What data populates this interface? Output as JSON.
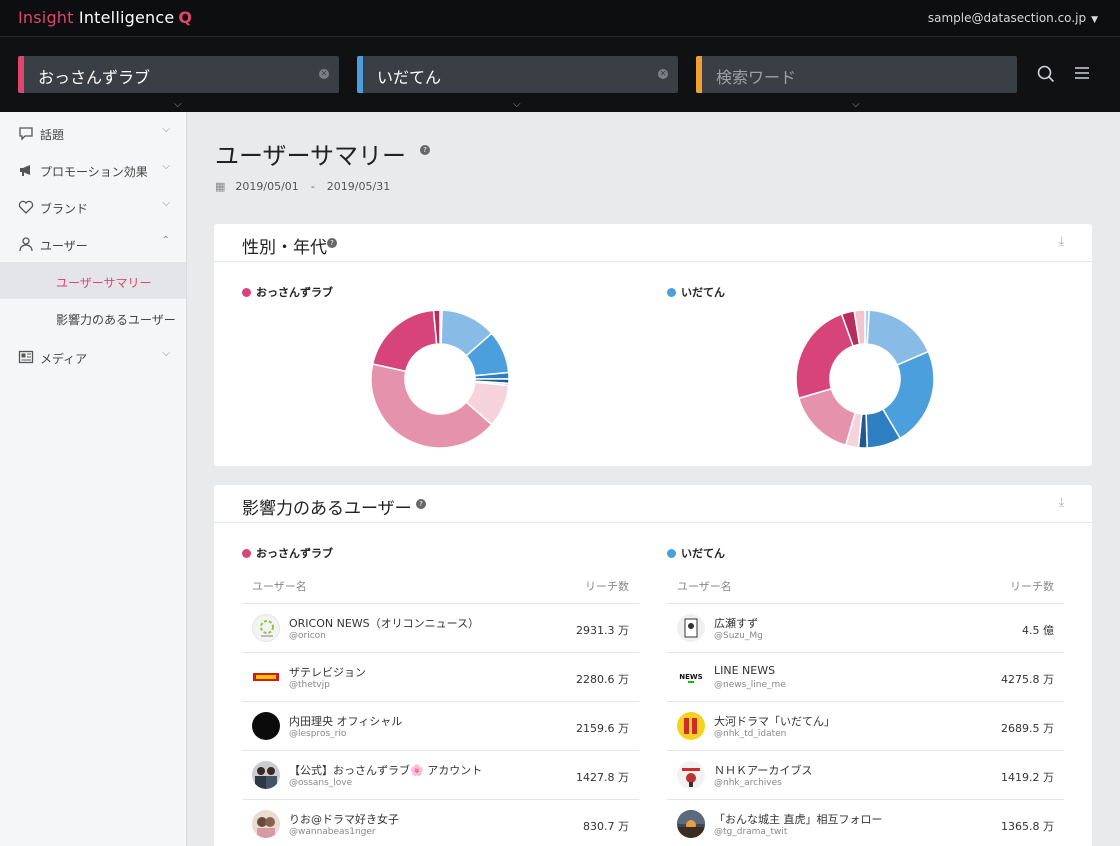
{
  "app": {
    "logo_part1": "Insight",
    "logo_part2": " Intelligence",
    "logo_mark": "Q",
    "user_email": "sample@datasection.co.jp",
    "accent": "#e0456f"
  },
  "search": {
    "fields": [
      {
        "value": "おっさんずラブ",
        "bar_color": "#e0456f"
      },
      {
        "value": "いだてん",
        "bar_color": "#4a9fdc"
      },
      {
        "value": "",
        "placeholder": "検索ワード",
        "bar_color": "#f0a030"
      }
    ]
  },
  "sidebar": {
    "items": [
      {
        "label": "話題",
        "icon": "speech-bubble-icon"
      },
      {
        "label": "プロモーション効果",
        "icon": "megaphone-icon"
      },
      {
        "label": "ブランド",
        "icon": "heart-icon"
      },
      {
        "label": "ユーザー",
        "icon": "user-icon"
      },
      {
        "label": "メディア",
        "icon": "newspaper-icon"
      }
    ],
    "subitems": [
      {
        "label": "ユーザーサマリー",
        "active": true
      },
      {
        "label": "影響力のあるユーザー",
        "active": false
      }
    ]
  },
  "page": {
    "title": "ユーザーサマリー",
    "date_from": "2019/05/01",
    "date_sep": "-",
    "date_to": "2019/05/31"
  },
  "demographics": {
    "title": "性別・年代",
    "chart_data": [
      {
        "type": "pie",
        "name": "おっさんずラブ",
        "legend_color": "#d6447a",
        "values": [
          0.5,
          13,
          10,
          1.5,
          1,
          0.5,
          10,
          42,
          20,
          1.5
        ],
        "colors": [
          "#a8d1ee",
          "#88bbe6",
          "#4a9fdc",
          "#2e7fc2",
          "#1f5a8f",
          "#8fc0e8",
          "#f6d2dc",
          "#e592ad",
          "#d6447a",
          "#b52d5c"
        ]
      },
      {
        "type": "pie",
        "name": "いだてん",
        "legend_color": "#4a9fdc",
        "values": [
          1,
          17.5,
          23,
          8,
          2,
          3,
          16,
          24,
          3,
          2.5
        ],
        "colors": [
          "#a8d1ee",
          "#88bbe6",
          "#4a9fdc",
          "#2e7fc2",
          "#1f5a8f",
          "#f6d2dc",
          "#e592ad",
          "#d6447a",
          "#b52d5c",
          "#f2c3d0"
        ]
      }
    ]
  },
  "influencers": {
    "title": "影響力のあるユーザー",
    "col_user": "ユーザー名",
    "col_reach": "リーチ数",
    "tables": [
      {
        "name": "おっさんずラブ",
        "color": "#d6447a",
        "rows": [
          {
            "name": "ORICON NEWS（オリコンニュース）",
            "handle": "@oricon",
            "reach": "2931.3 万",
            "avatar_color": "#f3f3f3"
          },
          {
            "name": "ザテレビジョン",
            "handle": "@thetvjp",
            "reach": "2280.6 万",
            "avatar_color": "#f6e7e7"
          },
          {
            "name": "内田理央 オフィシャル",
            "handle": "@lespros_rio",
            "reach": "2159.6 万",
            "avatar_color": "#0b0b0b"
          },
          {
            "name": "【公式】おっさんずラブ🌸 アカウント",
            "handle": "@ossans_love",
            "reach": "1427.8 万",
            "avatar_color": "#5a6470"
          },
          {
            "name": "りお@ドラマ好き女子",
            "handle": "@wannabeas1nger",
            "reach": "830.7 万",
            "avatar_color": "#d8b9a8"
          }
        ]
      },
      {
        "name": "いだてん",
        "color": "#4a9fdc",
        "rows": [
          {
            "name": "広瀬すず",
            "handle": "@Suzu_Mg",
            "reach": "4.5 億",
            "avatar_color": "#e8e8e8"
          },
          {
            "name": "LINE NEWS",
            "handle": "@news_line_me",
            "reach": "4275.8 万",
            "avatar_color": "#ffffff"
          },
          {
            "name": "大河ドラマ「いだてん」",
            "handle": "@nhk_td_idaten",
            "reach": "2689.5 万",
            "avatar_color": "#f4d21e"
          },
          {
            "name": "ＮＨＫアーカイブス",
            "handle": "@nhk_archives",
            "reach": "1419.2 万",
            "avatar_color": "#f2f2f2"
          },
          {
            "name": "「おんな城主 直虎」相互フォロー",
            "handle": "@tg_drama_twit",
            "reach": "1365.8 万",
            "avatar_color": "#6b5a3f"
          }
        ]
      }
    ]
  }
}
